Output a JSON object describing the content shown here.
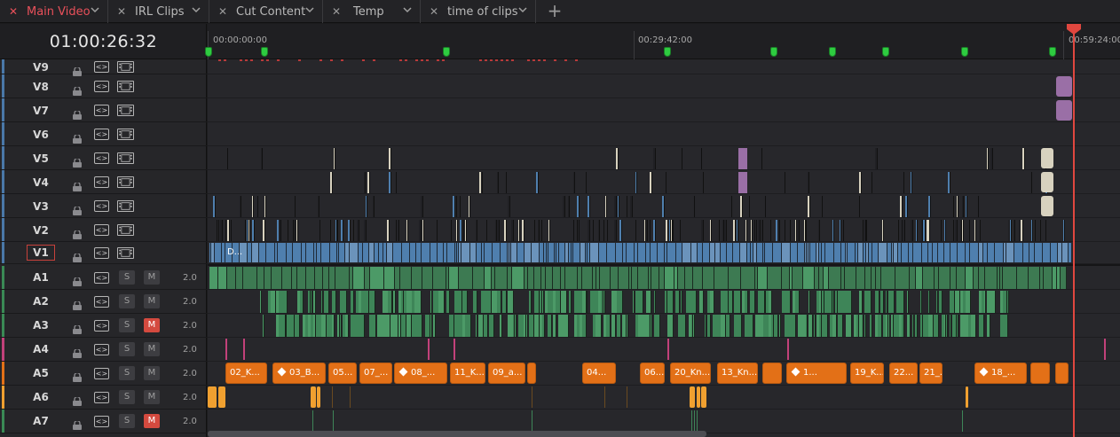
{
  "tabs": [
    {
      "label": "Main Video",
      "active": true
    },
    {
      "label": "IRL Clips",
      "active": false
    },
    {
      "label": "Cut Content",
      "active": false
    },
    {
      "label": "Temp",
      "active": false
    },
    {
      "label": "time of clips",
      "active": false
    }
  ],
  "add_tab_symbol": "+",
  "timecode": "01:00:26:32",
  "ruler_labels": [
    "00:00:00:00",
    "00:29:42:00",
    "00:59:24:00"
  ],
  "video_tracks": [
    {
      "name": "V9",
      "color": "#4a78a8"
    },
    {
      "name": "V8",
      "color": "#4a78a8"
    },
    {
      "name": "V7",
      "color": "#4a78a8"
    },
    {
      "name": "V6",
      "color": "#4a78a8"
    },
    {
      "name": "V5",
      "color": "#4a78a8"
    },
    {
      "name": "V4",
      "color": "#4a78a8"
    },
    {
      "name": "V3",
      "color": "#4a78a8"
    },
    {
      "name": "V2",
      "color": "#4a78a8"
    },
    {
      "name": "V1",
      "color": "#4a78a8",
      "selected": true
    }
  ],
  "audio_tracks": [
    {
      "name": "A1",
      "color": "#3a8a55",
      "channels": "2.0",
      "muted": false
    },
    {
      "name": "A2",
      "color": "#3a8a55",
      "channels": "2.0",
      "muted": false
    },
    {
      "name": "A3",
      "color": "#3a8a55",
      "channels": "2.0",
      "muted": true
    },
    {
      "name": "A4",
      "color": "#c2417a",
      "channels": "2.0",
      "muted": false
    },
    {
      "name": "A5",
      "color": "#e37017",
      "channels": "2.0",
      "muted": false
    },
    {
      "name": "A6",
      "color": "#f0a030",
      "channels": "2.0",
      "muted": false
    },
    {
      "name": "A7",
      "color": "#3a8a55",
      "channels": "2.0",
      "muted": true
    }
  ],
  "solo_label": "S",
  "mute_label": "M",
  "v1_clip_label": "D...",
  "a5_clips": [
    {
      "label": "02_K...",
      "kf": false
    },
    {
      "label": "03_B...",
      "kf": true
    },
    {
      "label": "05...",
      "kf": false
    },
    {
      "label": "07_...",
      "kf": false
    },
    {
      "label": "08_...",
      "kf": true
    },
    {
      "label": "11_K...",
      "kf": false
    },
    {
      "label": "09_a...",
      "kf": false
    },
    {
      "label": "04...",
      "kf": false
    },
    {
      "label": "06...",
      "kf": false
    },
    {
      "label": "20_Kn...",
      "kf": false
    },
    {
      "label": "13_Kn...",
      "kf": false
    },
    {
      "label": "1...",
      "kf": true
    },
    {
      "label": "19_K...",
      "kf": false
    },
    {
      "label": "22...",
      "kf": false
    },
    {
      "label": "21_...",
      "kf": false
    },
    {
      "label": "18_...",
      "kf": true
    }
  ],
  "colors": {
    "video_clip": "#4f7fae",
    "video_clip_light": "#d8d2bf",
    "purple_clip": "#9a6fa6",
    "audio_green": "#3d7a52",
    "audio_green_light": "#4c9a67",
    "audio_pink": "#c2417a",
    "audio_orange": "#e37017",
    "audio_amber": "#f0a030",
    "playhead": "#e0473f",
    "marker": "#2ecc40",
    "active_tab": "#e8505a"
  }
}
